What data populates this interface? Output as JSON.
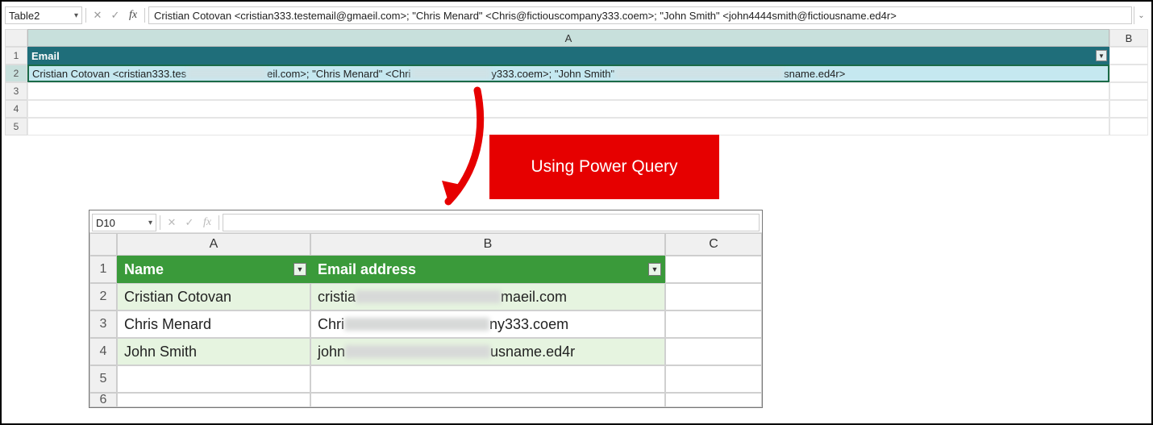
{
  "top": {
    "name_box": "Table2",
    "formula": "Cristian Cotovan <cristian333.testemail@gmaeil.com>; \"Chris Menard\" <Chris@fictiouscompany333.coem>; \"John Smith\" <john4444smith@fictiousname.ed4r>",
    "columns": {
      "A": "A",
      "B": "B"
    },
    "rows": [
      "1",
      "2",
      "3",
      "4",
      "5"
    ],
    "header": "Email",
    "cell2": {
      "part1": "Cristian Cotovan <cristian333.tes",
      "part2": "eil.com>; \"Chris Menard\" <Chri",
      "part3": "y333.coem>; \"John Smith\"",
      "part4": "sname.ed4r>"
    }
  },
  "annotation": "Using Power Query",
  "bottom": {
    "name_box": "D10",
    "columns": {
      "A": "A",
      "B": "B",
      "C": "C"
    },
    "row_labels": [
      "1",
      "2",
      "3",
      "4",
      "5",
      "6"
    ],
    "headers": {
      "name": "Name",
      "email": "Email address"
    },
    "rows": [
      {
        "name": "Cristian Cotovan",
        "email_pre": "cristia",
        "email_post": "maeil.com"
      },
      {
        "name": "Chris Menard",
        "email_pre": "Chri",
        "email_post": "ny333.coem"
      },
      {
        "name": "John Smith",
        "email_pre": "john",
        "email_post": "usname.ed4r"
      }
    ]
  },
  "icons": {
    "dropdown": "▾",
    "cancel": "✕",
    "accept": "✓",
    "fx": "fx",
    "filter": "▼",
    "expand": "⌄"
  }
}
